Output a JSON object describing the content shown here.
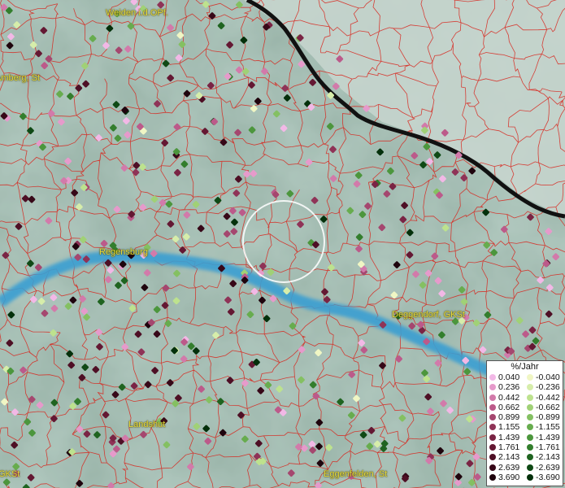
{
  "map": {
    "cities": [
      {
        "id": "weiden",
        "label": "Weiden i.d.OPf."
      },
      {
        "id": "amberg",
        "label": "Amberg, St"
      },
      {
        "id": "regensburg",
        "label": "Regensburg"
      },
      {
        "id": "deggendorf",
        "label": "Deggendorf, GKSt"
      },
      {
        "id": "landshut",
        "label": "Landshut"
      },
      {
        "id": "eggenfelden",
        "label": "Eggenfelden, St"
      },
      {
        "id": "gkst-left",
        "label": "GKSt"
      }
    ],
    "colors": {
      "terrain": "#9fb8ad",
      "admin_border": "#d8241c",
      "national_border": "#111111",
      "river": "#3b9fd2",
      "city_label": "#e8dc3c",
      "selection_circle": "#ffffff"
    }
  },
  "legend": {
    "title": "%/Jahr",
    "positive": [
      {
        "label": "0.040",
        "color": "#f2b8e6"
      },
      {
        "label": "0.236",
        "color": "#e69acb"
      },
      {
        "label": "0.442",
        "color": "#d27aaa"
      },
      {
        "label": "0.662",
        "color": "#bc5a8a"
      },
      {
        "label": "0.899",
        "color": "#a5476f"
      },
      {
        "label": "1.155",
        "color": "#8f3357"
      },
      {
        "label": "1.439",
        "color": "#7a2444"
      },
      {
        "label": "1.761",
        "color": "#641833"
      },
      {
        "label": "2.143",
        "color": "#4e0f25"
      },
      {
        "label": "2.639",
        "color": "#370818"
      },
      {
        "label": "3.690",
        "color": "#1f040d"
      }
    ],
    "negative": [
      {
        "label": "-0.040",
        "color": "#f0f6c4"
      },
      {
        "label": "-0.236",
        "color": "#d6edaa"
      },
      {
        "label": "-0.442",
        "color": "#bde28e"
      },
      {
        "label": "-0.662",
        "color": "#a0d176"
      },
      {
        "label": "-0.899",
        "color": "#84c062"
      },
      {
        "label": "-1.155",
        "color": "#67ac4e"
      },
      {
        "label": "-1.439",
        "color": "#4c963d"
      },
      {
        "label": "-1.761",
        "color": "#337e2d"
      },
      {
        "label": "-2.143",
        "color": "#1f6420"
      },
      {
        "label": "-2.639",
        "color": "#0f4915"
      },
      {
        "label": "-3.690",
        "color": "#04300b"
      }
    ]
  }
}
